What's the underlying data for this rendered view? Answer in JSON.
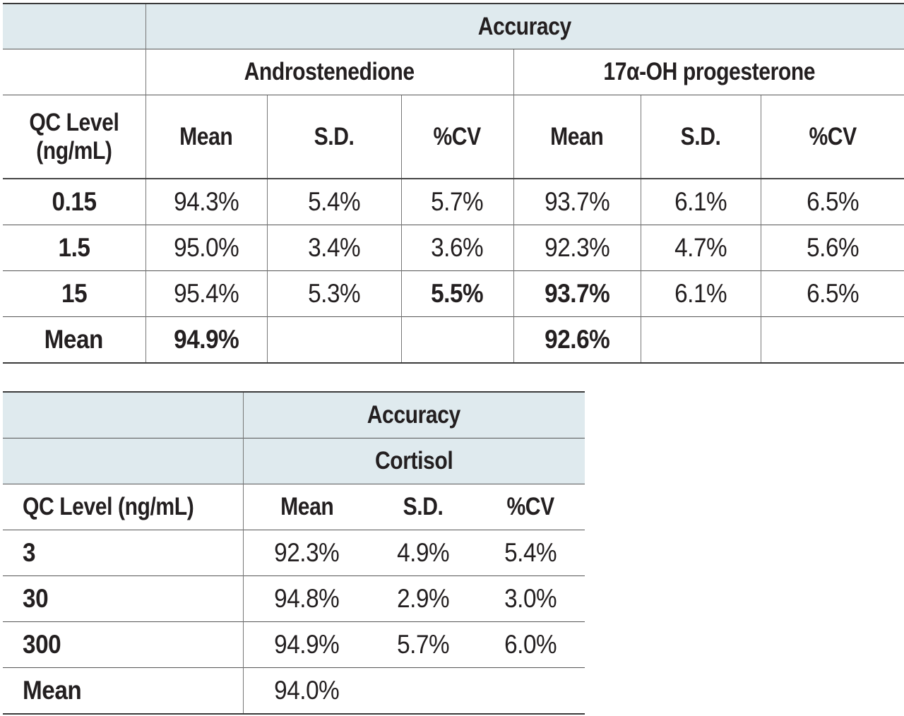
{
  "table1": {
    "group_header": "Accuracy",
    "analytes": [
      "Androstenedione",
      "17α-OH progesterone"
    ],
    "row_header_label": "QC Level\n(ng/mL)",
    "row_header_lines": [
      "QC Level",
      "(ng/mL)"
    ],
    "columns": [
      "Mean",
      "S.D.",
      "%CV",
      "Mean",
      "S.D.",
      "%CV"
    ],
    "rows": [
      {
        "level": "0.15",
        "values": [
          "94.3%",
          "5.4%",
          "5.7%",
          "93.7%",
          "6.1%",
          "6.5%"
        ]
      },
      {
        "level": "1.5",
        "values": [
          "95.0%",
          "3.4%",
          "3.6%",
          "92.3%",
          "4.7%",
          "5.6%"
        ]
      },
      {
        "level": "15",
        "values": [
          "95.4%",
          "5.3%",
          "5.5%",
          "93.7%",
          "6.1%",
          "6.5%"
        ]
      },
      {
        "level": "Mean",
        "values": [
          "94.9%",
          "",
          "",
          "92.6%",
          "",
          ""
        ]
      }
    ]
  },
  "table2": {
    "group_header": "Accuracy",
    "analyte": "Cortisol",
    "row_header_label": "QC Level (ng/mL)",
    "columns": [
      "Mean",
      "S.D.",
      "%CV"
    ],
    "rows": [
      {
        "level": "3",
        "values": [
          "92.3%",
          "4.9%",
          "5.4%"
        ]
      },
      {
        "level": "30",
        "values": [
          "94.8%",
          "2.9%",
          "3.0%"
        ]
      },
      {
        "level": "300",
        "values": [
          "94.9%",
          "5.7%",
          "6.0%"
        ]
      },
      {
        "level": "Mean",
        "values": [
          "94.0%",
          "",
          ""
        ]
      }
    ]
  }
}
